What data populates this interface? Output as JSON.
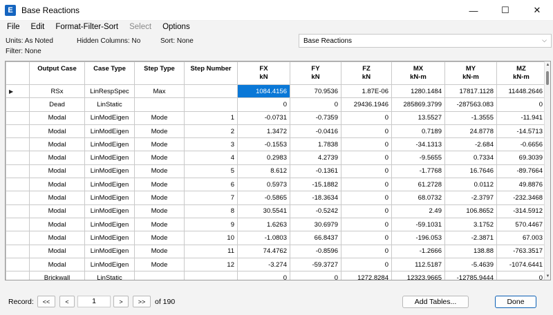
{
  "window": {
    "icon_letter": "E",
    "title": "Base Reactions",
    "minimize": "—",
    "maximize": "☐",
    "close": "✕"
  },
  "menu": [
    "File",
    "Edit",
    "Format-Filter-Sort",
    "Select",
    "Options"
  ],
  "info": {
    "units": "Units:  As Noted",
    "hidden": "Hidden Columns:  No",
    "sort": "Sort:  None",
    "filter": "Filter:  None"
  },
  "table_select": {
    "value": "Base Reactions"
  },
  "columns": [
    {
      "name": "Output Case",
      "unit": ""
    },
    {
      "name": "Case Type",
      "unit": ""
    },
    {
      "name": "Step Type",
      "unit": ""
    },
    {
      "name": "Step Number",
      "unit": ""
    },
    {
      "name": "FX",
      "unit": "kN"
    },
    {
      "name": "FY",
      "unit": "kN"
    },
    {
      "name": "FZ",
      "unit": "kN"
    },
    {
      "name": "MX",
      "unit": "kN-m"
    },
    {
      "name": "MY",
      "unit": "kN-m"
    },
    {
      "name": "MZ",
      "unit": "kN-m"
    }
  ],
  "rows": [
    [
      "RSx",
      "LinRespSpec",
      "Max",
      "",
      "1084.4156",
      "70.9536",
      "1.87E-06",
      "1280.1484",
      "17817.1128",
      "11448.2646"
    ],
    [
      "Dead",
      "LinStatic",
      "",
      "",
      "0",
      "0",
      "29436.1946",
      "285869.3799",
      "-287563.083",
      "0"
    ],
    [
      "Modal",
      "LinModEigen",
      "Mode",
      "1",
      "-0.0731",
      "-0.7359",
      "0",
      "13.5527",
      "-1.3555",
      "-11.941"
    ],
    [
      "Modal",
      "LinModEigen",
      "Mode",
      "2",
      "1.3472",
      "-0.0416",
      "0",
      "0.7189",
      "24.8778",
      "-14.5713"
    ],
    [
      "Modal",
      "LinModEigen",
      "Mode",
      "3",
      "-0.1553",
      "1.7838",
      "0",
      "-34.1313",
      "-2.684",
      "-0.6656"
    ],
    [
      "Modal",
      "LinModEigen",
      "Mode",
      "4",
      "0.2983",
      "4.2739",
      "0",
      "-9.5655",
      "0.7334",
      "69.3039"
    ],
    [
      "Modal",
      "LinModEigen",
      "Mode",
      "5",
      "8.612",
      "-0.1361",
      "0",
      "-1.7768",
      "16.7646",
      "-89.7664"
    ],
    [
      "Modal",
      "LinModEigen",
      "Mode",
      "6",
      "0.5973",
      "-15.1882",
      "0",
      "61.2728",
      "0.0112",
      "49.8876"
    ],
    [
      "Modal",
      "LinModEigen",
      "Mode",
      "7",
      "-0.5865",
      "-18.3634",
      "0",
      "68.0732",
      "-2.3797",
      "-232.3468"
    ],
    [
      "Modal",
      "LinModEigen",
      "Mode",
      "8",
      "30.5541",
      "-0.5242",
      "0",
      "2.49",
      "106.8652",
      "-314.5912"
    ],
    [
      "Modal",
      "LinModEigen",
      "Mode",
      "9",
      "1.6263",
      "30.6979",
      "0",
      "-59.1031",
      "3.1752",
      "570.4467"
    ],
    [
      "Modal",
      "LinModEigen",
      "Mode",
      "10",
      "-1.0803",
      "66.8437",
      "0",
      "-196.053",
      "-2.3871",
      "67.003"
    ],
    [
      "Modal",
      "LinModEigen",
      "Mode",
      "11",
      "74.4762",
      "-0.8596",
      "0",
      "-1.2666",
      "138.88",
      "-763.3517"
    ],
    [
      "Modal",
      "LinModEigen",
      "Mode",
      "12",
      "-3.274",
      "-59.3727",
      "0",
      "112.5187",
      "-5.4639",
      "-1074.6441"
    ],
    [
      "Brickwall",
      "LinStatic",
      "",
      "",
      "0",
      "0",
      "1272.8284",
      "12323.9665",
      "-12785.9444",
      "0"
    ]
  ],
  "record": {
    "label": "Record:",
    "first": "<<",
    "prev": "<",
    "current": "1",
    "next": ">",
    "last": ">>",
    "of": "of 190"
  },
  "buttons": {
    "add_tables": "Add Tables...",
    "done": "Done"
  }
}
